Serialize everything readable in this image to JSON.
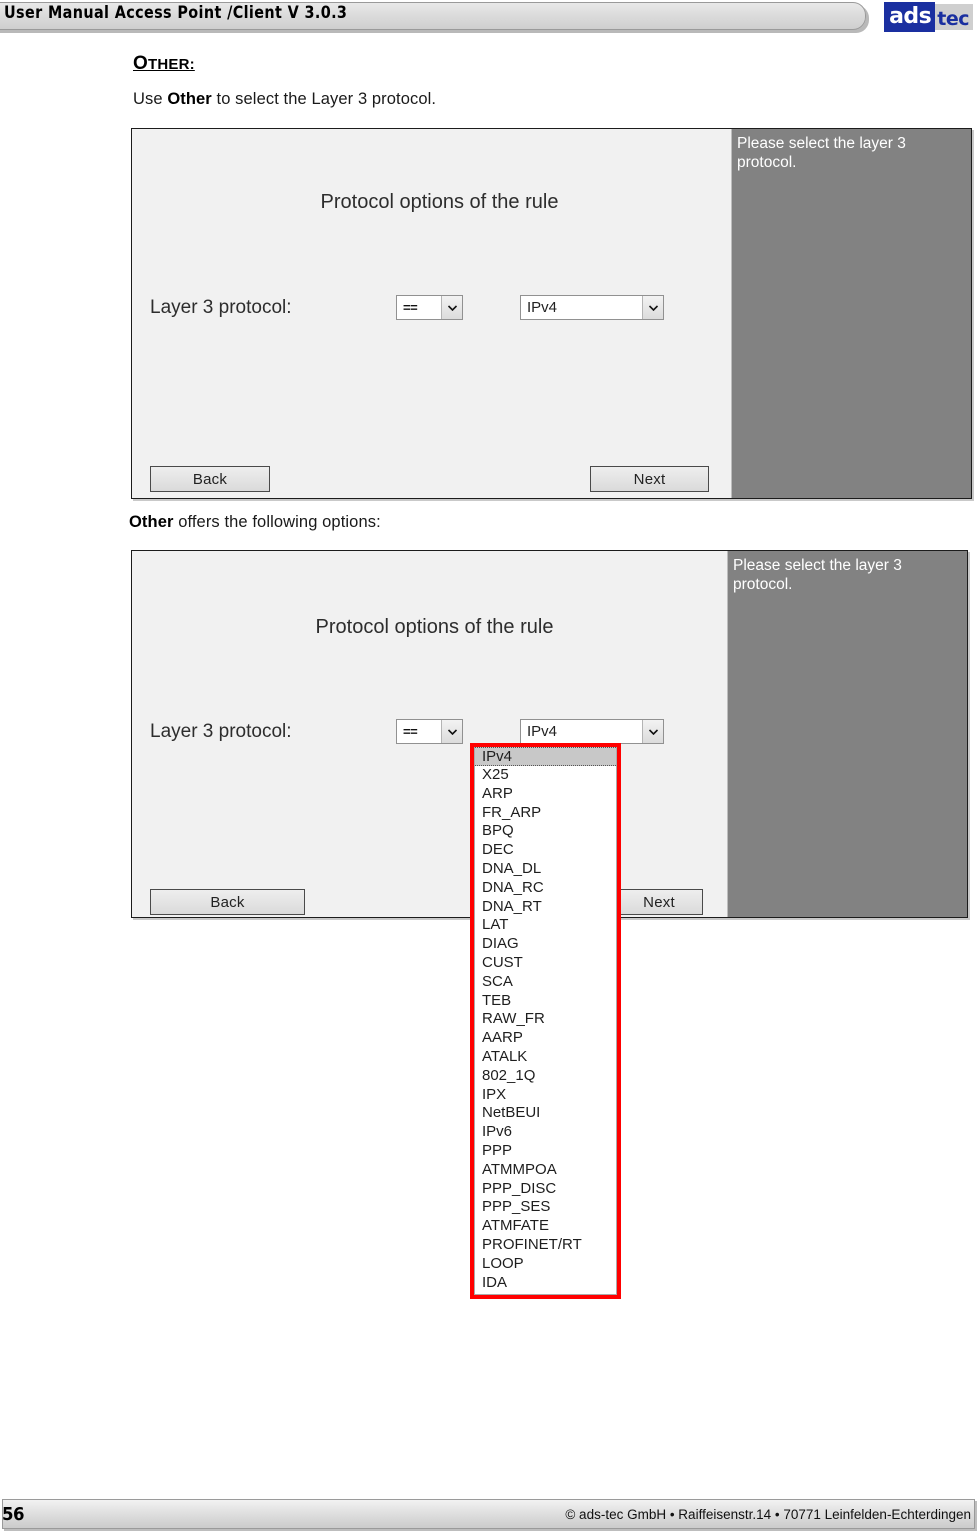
{
  "header": {
    "title": "User Manual Access Point /Client V 3.0.3",
    "logo_primary": "ads",
    "logo_secondary": "tec"
  },
  "section": {
    "heading_cap": "O",
    "heading_rest": "THER:",
    "intro_prefix": "Use ",
    "intro_bold": "Other",
    "intro_suffix": " to select the Layer 3 protocol.",
    "options_bold": "Other",
    "options_suffix": " offers the following options:"
  },
  "screenshot1": {
    "title": "Protocol options of the rule",
    "field_label": "Layer 3 protocol:",
    "operator_value": "==",
    "protocol_value": "IPv4",
    "back_label": "Back",
    "next_label": "Next",
    "help_text": "Please select the layer 3 protocol."
  },
  "screenshot2": {
    "title": "Protocol options of the rule",
    "field_label": "Layer 3 protocol:",
    "operator_value": "==",
    "protocol_value": "IPv4",
    "back_label": "Back",
    "next_label": "Next",
    "help_text": "Please select the layer 3 protocol.",
    "dropdown_options": [
      "IPv4",
      "X25",
      "ARP",
      "FR_ARP",
      "BPQ",
      "DEC",
      "DNA_DL",
      "DNA_RC",
      "DNA_RT",
      "LAT",
      "DIAG",
      "CUST",
      "SCA",
      "TEB",
      "RAW_FR",
      "AARP",
      "ATALK",
      "802_1Q",
      "IPX",
      "NetBEUI",
      "IPv6",
      "PPP",
      "ATMMPOA",
      "PPP_DISC",
      "PPP_SES",
      "ATMFATE",
      "PROFINET/RT",
      "LOOP",
      "IDA"
    ],
    "dropdown_selected_index": 0,
    "highlight_color": "#ff0000"
  },
  "footer": {
    "page_number": "56",
    "copyright": "© ads-tec GmbH • Raiffeisenstr.14 • 70771 Leinfelden-Echterdingen"
  }
}
